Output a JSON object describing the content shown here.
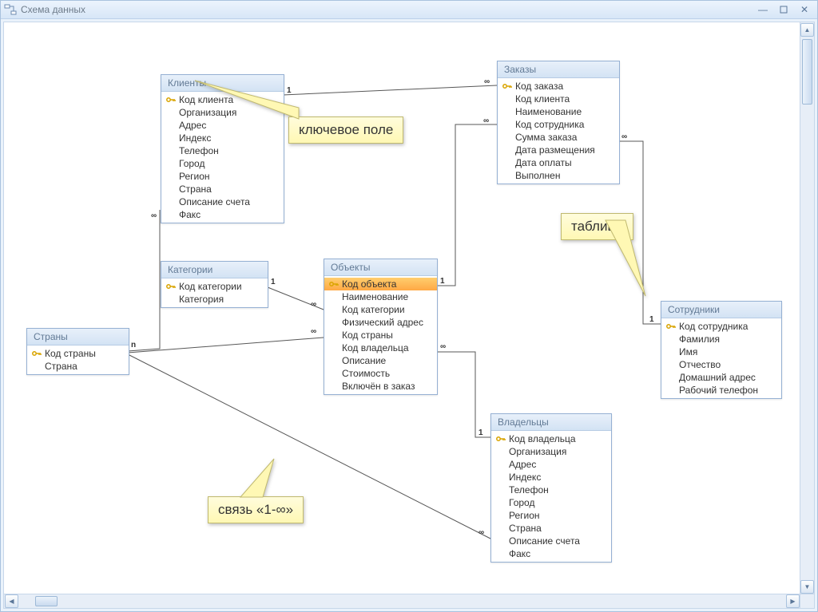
{
  "window": {
    "title": "Схема данных"
  },
  "callouts": {
    "keyfield": "ключевое поле",
    "table": "таблица",
    "relation": "связь «1-∞»"
  },
  "cardinality": {
    "one": "1",
    "many": "∞",
    "n": "n"
  },
  "tables": {
    "clients": {
      "title": "Клиенты",
      "fields": [
        "Код клиента",
        "Организация",
        "Адрес",
        "Индекс",
        "Телефон",
        "Город",
        "Регион",
        "Страна",
        "Описание счета",
        "Факс"
      ],
      "keys": [
        0
      ]
    },
    "categories": {
      "title": "Категории",
      "fields": [
        "Код категории",
        "Категория"
      ],
      "keys": [
        0
      ]
    },
    "countries": {
      "title": "Страны",
      "fields": [
        "Код страны",
        "Страна"
      ],
      "keys": [
        0
      ]
    },
    "objects": {
      "title": "Объекты",
      "fields": [
        "Код объекта",
        "Наименование",
        "Код категории",
        "Физический адрес",
        "Код страны",
        "Код владельца",
        "Описание",
        "Стоимость",
        "Включён в заказ"
      ],
      "keys": [
        0
      ],
      "selected": 0
    },
    "orders": {
      "title": "Заказы",
      "fields": [
        "Код заказа",
        "Код клиента",
        "Наименование",
        "Код сотрудника",
        "Сумма заказа",
        "Дата размещения",
        "Дата оплаты",
        "Выполнен"
      ],
      "keys": [
        0
      ]
    },
    "employees": {
      "title": "Сотрудники",
      "fields": [
        "Код сотрудника",
        "Фамилия",
        "Имя",
        "Отчество",
        "Домашний адрес",
        "Рабочий телефон"
      ],
      "keys": [
        0
      ]
    },
    "owners": {
      "title": "Владельцы",
      "fields": [
        "Код владельца",
        "Организация",
        "Адрес",
        "Индекс",
        "Телефон",
        "Город",
        "Регион",
        "Страна",
        "Описание счета",
        "Факс"
      ],
      "keys": [
        0
      ]
    }
  }
}
